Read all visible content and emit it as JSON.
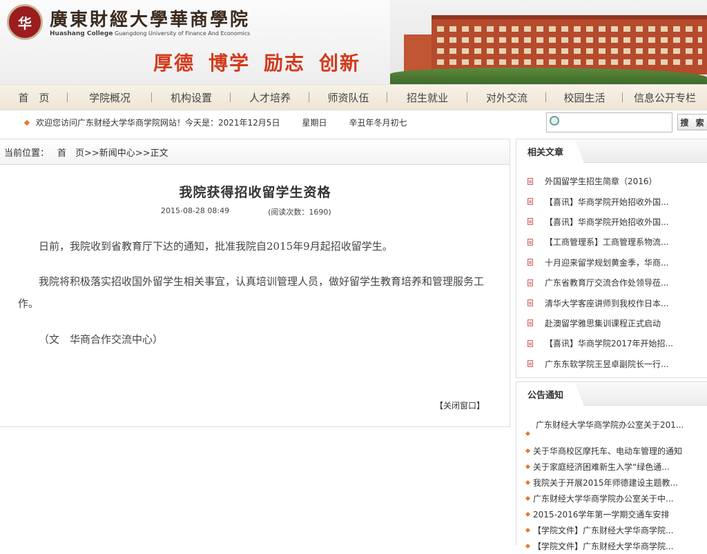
{
  "header": {
    "logo_char": "华",
    "school_name_cn": "廣東財經大學華商學院",
    "school_name_en_bold": "Huashang College",
    "school_name_en": "Guangdong University of Finance And Economics",
    "slogans": [
      "厚德",
      "博学",
      "励志",
      "创新"
    ]
  },
  "nav": {
    "items": [
      "首　页",
      "学院概况",
      "机构设置",
      "人才培养",
      "师资队伍",
      "招生就业",
      "对外交流",
      "校园生活",
      "信息公开专栏"
    ]
  },
  "infobar": {
    "welcome": "欢迎您访问广东财经大学华商学院网站！今天是：2021年12月5日",
    "weekday": "星期日",
    "lunar": "辛丑年冬月初七"
  },
  "search": {
    "placeholder": "",
    "button_label": "搜 索"
  },
  "breadcrumb": {
    "label": "当前位置：",
    "path": "首　页>>新闻中心>>正文"
  },
  "article": {
    "title": "我院获得招收留学生资格",
    "datetime": "2015-08-28 08:49",
    "views": "(阅读次数：1690)",
    "paragraphs": [
      "日前，我院收到省教育厅下达的通知，批准我院自2015年9月起招收留学生。",
      "我院将积极落实招收国外留学生相关事宜，认真培训管理人员，做好留学生教育培养和管理服务工作。",
      "（文　华商合作交流中心）"
    ],
    "close_label": "【关闭窗口】"
  },
  "related": {
    "title": "相关文章",
    "items": [
      "外国留学生招生简章（2016）",
      "【喜讯】华商学院开始招收外国...",
      "【喜讯】华商学院开始招收外国...",
      "【工商管理系】工商管理系物流...",
      "十月迎来留学规划黄金季，华商...",
      "广东省教育厅交流合作处领导莅...",
      "清华大学客座讲师到我校作日本...",
      "赴澳留学雅思集训课程正式启动",
      "【喜讯】华商学院2017年开始招...",
      "广东东软学院王昱卓副院长一行..."
    ]
  },
  "notices": {
    "title": "公告通知",
    "items": [
      "广东财经大学华商学院办公室关于201...",
      "关于华商校区摩托车、电动车管理的通知",
      "关于家庭经济困难新生入学“绿色通...",
      "我院关于开展2015年师德建设主题教...",
      "广东财经大学华商学院办公室关于中...",
      "2015-2016学年第一学期交通车安排",
      "【学院文件】广东财经大学华商学院...",
      "【学院文件】广东财经大学华商学院..."
    ]
  },
  "colors": {
    "accent": "#e8782c",
    "slogan": "#d23a1c",
    "brand": "#9b1d1d"
  }
}
